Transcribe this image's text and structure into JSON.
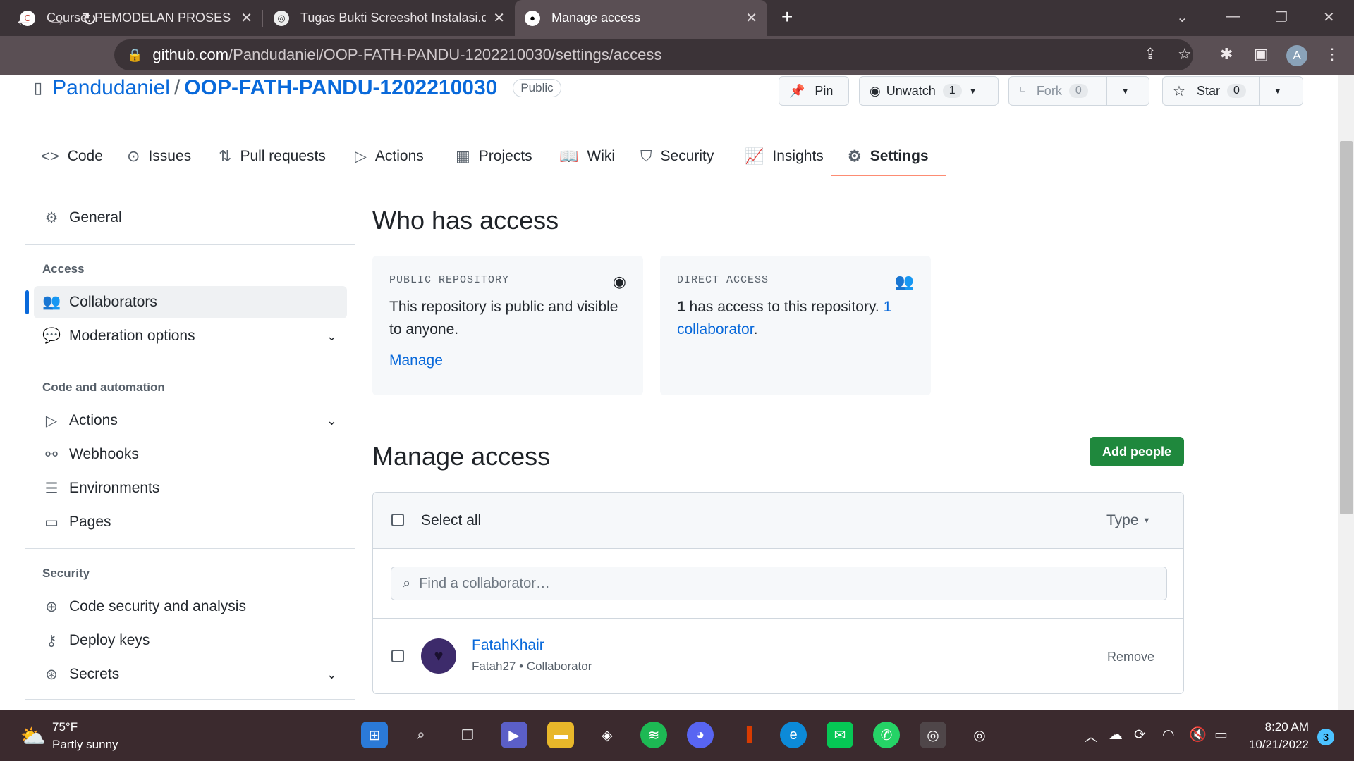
{
  "browser": {
    "tabs": [
      {
        "title": "Course: PEMODELAN PROSES BIS"
      },
      {
        "title": "Tugas Bukti Screeshot Instalasi.d"
      },
      {
        "title": "Manage access"
      }
    ],
    "url_host": "github.com",
    "url_path": "/Pandudaniel/OOP-FATH-PANDU-1202210030/settings/access",
    "profile_initial": "A"
  },
  "repo": {
    "owner": "Pandudaniel",
    "separator": "/",
    "name": "OOP-FATH-PANDU-1202210030",
    "visibility": "Public",
    "pin_label": "Pin",
    "unwatch_label": "Unwatch",
    "watch_count": "1",
    "fork_label": "Fork",
    "fork_count": "0",
    "star_label": "Star",
    "star_count": "0"
  },
  "repo_tabs": [
    {
      "label": "Code",
      "icon": "code-icon"
    },
    {
      "label": "Issues",
      "icon": "issue-icon"
    },
    {
      "label": "Pull requests",
      "icon": "pull-request-icon"
    },
    {
      "label": "Actions",
      "icon": "play-icon"
    },
    {
      "label": "Projects",
      "icon": "table-icon"
    },
    {
      "label": "Wiki",
      "icon": "book-icon"
    },
    {
      "label": "Security",
      "icon": "shield-icon"
    },
    {
      "label": "Insights",
      "icon": "graph-icon"
    },
    {
      "label": "Settings",
      "icon": "gear-icon"
    }
  ],
  "sidebar": {
    "general": "General",
    "access_heading": "Access",
    "collaborators": "Collaborators",
    "moderation": "Moderation options",
    "code_heading": "Code and automation",
    "actions": "Actions",
    "webhooks": "Webhooks",
    "environments": "Environments",
    "pages": "Pages",
    "security_heading": "Security",
    "code_security": "Code security and analysis",
    "deploy_keys": "Deploy keys",
    "secrets": "Secrets"
  },
  "who_has_access": {
    "title": "Who has access",
    "public_label": "PUBLIC REPOSITORY",
    "public_text": "This repository is public and visible to anyone.",
    "manage_link": "Manage",
    "direct_label": "DIRECT ACCESS",
    "direct_count": "1",
    "direct_text": " has access to this repository. ",
    "collaborator_link": "1 collaborator",
    "period": "."
  },
  "manage_access": {
    "title": "Manage access",
    "add_button": "Add people",
    "select_all": "Select all",
    "type_filter": "Type",
    "search_placeholder": "Find a collaborator…",
    "collaborators": [
      {
        "name": "FatahKhair",
        "username": "Fatah27",
        "role": "Collaborator",
        "action": "Remove"
      }
    ]
  },
  "taskbar": {
    "weather_temp": "75°F",
    "weather_desc": "Partly sunny",
    "time": "8:20 AM",
    "date": "10/21/2022",
    "notification_count": "3"
  },
  "colors": {
    "link": "#0969da",
    "green_button": "#1f883d",
    "tab_underline": "#fd8c73",
    "chrome_frame": "#3b3337"
  }
}
